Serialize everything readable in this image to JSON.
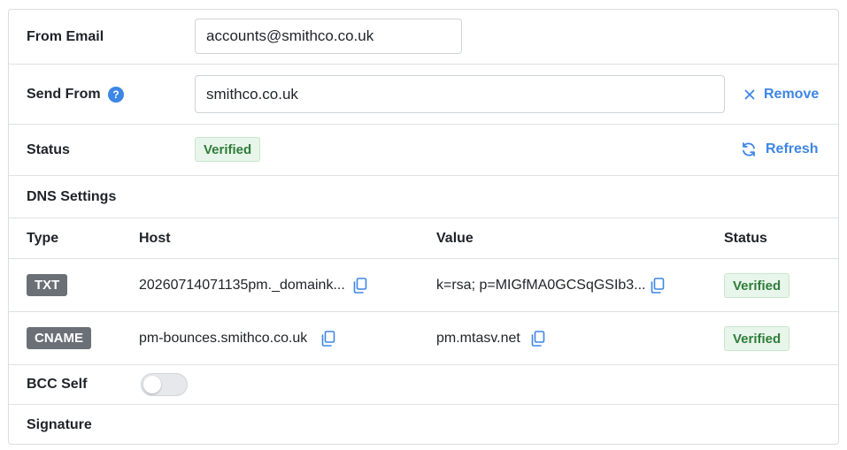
{
  "from_email": {
    "label": "From Email",
    "value": "accounts@smithco.co.uk"
  },
  "send_from": {
    "label": "Send From",
    "help_glyph": "?",
    "value": "smithco.co.uk",
    "remove_label": "Remove"
  },
  "status": {
    "label": "Status",
    "badge": "Verified",
    "refresh_label": "Refresh"
  },
  "dns": {
    "title": "DNS Settings",
    "columns": [
      "Type",
      "Host",
      "Value",
      "Status"
    ],
    "rows": [
      {
        "type": "TXT",
        "host": "20260714071135pm._domaink...",
        "value": "k=rsa; p=MIGfMA0GCSqGSIb3...",
        "status": "Verified"
      },
      {
        "type": "CNAME",
        "host": "pm-bounces.smithco.co.uk",
        "value": "pm.mtasv.net",
        "status": "Verified"
      }
    ]
  },
  "bcc_self": {
    "label": "BCC Self",
    "enabled": false
  },
  "signature": {
    "label": "Signature"
  },
  "colors": {
    "accent": "#3d86e5",
    "verified_bg": "#e8f5ea",
    "verified_text": "#2e7d3a",
    "type_badge": "#6b7077"
  }
}
